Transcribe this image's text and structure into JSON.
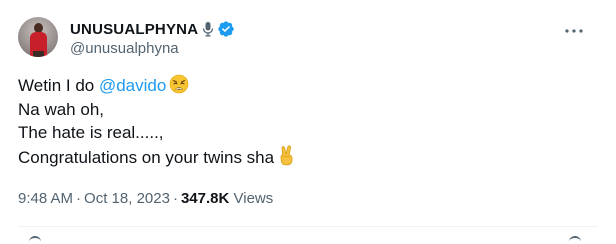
{
  "tweet": {
    "display_name": "UNUSUALPHYNA",
    "handle": "@unusualphyna",
    "lines": [
      {
        "before": "Wetin I do ",
        "mention": "@davido",
        "emoji": "weary-face"
      },
      {
        "text": "Na wah oh,"
      },
      {
        "text": "The hate is real.....,"
      },
      {
        "text": "Congratulations on your twins sha",
        "emoji": "victory-hand"
      }
    ],
    "meta": {
      "time": "9:48 AM",
      "date": "Oct 18, 2023",
      "views_count": "347.8K",
      "views_label": "Views"
    }
  },
  "colors": {
    "text": "#0f1419",
    "secondary": "#536471",
    "accent": "#1d9bf0",
    "divider": "#eff3f4"
  },
  "icons": {
    "mic": "microphone-icon",
    "verified": "verified-badge-icon",
    "more": "more-options-icon"
  }
}
